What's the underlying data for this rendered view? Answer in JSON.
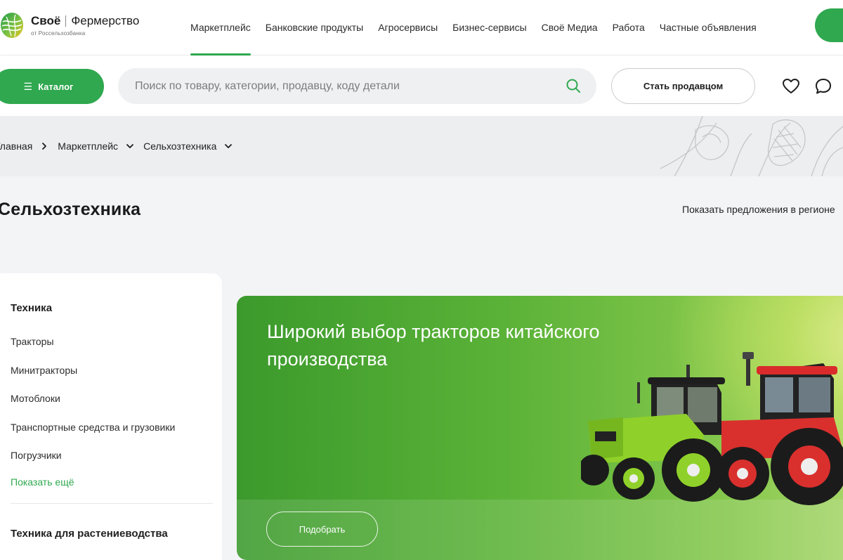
{
  "header": {
    "brand": "Своё",
    "brand_suffix": "Фермерство",
    "brand_sub": "от Россельхозбанка",
    "nav": [
      {
        "label": "Маркетплейс",
        "active": true
      },
      {
        "label": "Банковские продукты",
        "active": false
      },
      {
        "label": "Агросервисы",
        "active": false
      },
      {
        "label": "Бизнес-сервисы",
        "active": false
      },
      {
        "label": "Своё Медиа",
        "active": false
      },
      {
        "label": "Работа",
        "active": false
      },
      {
        "label": "Частные объявления",
        "active": false
      }
    ]
  },
  "toolbar": {
    "catalog_label": "Каталог",
    "search_placeholder": "Поиск по товару, категории, продавцу, коду детали",
    "seller_label": "Стать продавцом"
  },
  "breadcrumb": [
    {
      "label": "Главная"
    },
    {
      "label": "Маркетплейс"
    },
    {
      "label": "Сельхозтехника"
    }
  ],
  "page": {
    "title": "Сельхозтехника",
    "region_link": "Показать предложения в регионе"
  },
  "sidebar": {
    "groups": [
      {
        "title": "Техника",
        "items": [
          "Тракторы",
          "Минитракторы",
          "Мотоблоки",
          "Транспортные средства и грузовики",
          "Погрузчики"
        ],
        "more": "Показать ещё"
      },
      {
        "title": "Техника для растениеводства"
      }
    ]
  },
  "banner": {
    "title": "Широкий выбор тракторов китайского производства",
    "button": "Подобрать"
  },
  "colors": {
    "accent": "#2fa84f",
    "text": "#1d1d1f",
    "band": "#eceef0"
  }
}
